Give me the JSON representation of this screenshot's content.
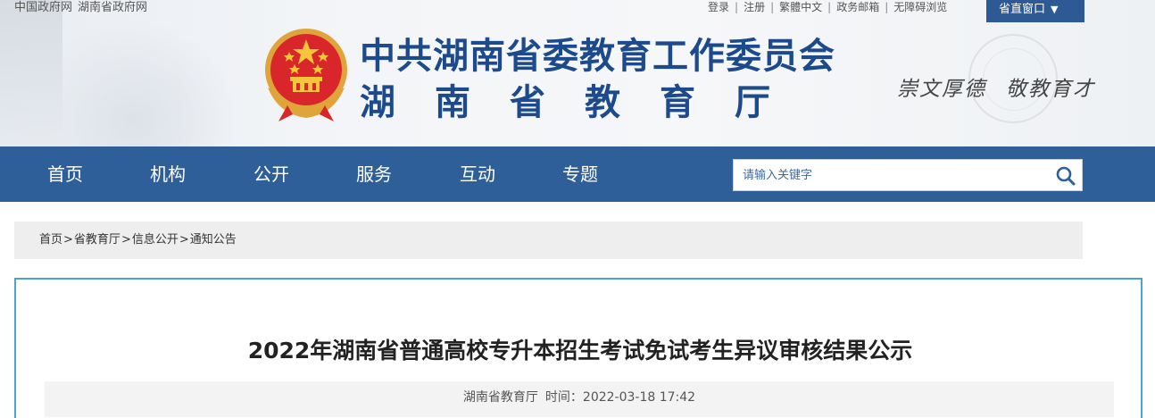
{
  "top_links": {
    "left": [
      "中国政府网",
      "湖南省政府网"
    ],
    "right": [
      "登录",
      "注册",
      "繁體中文",
      "政务邮箱",
      "无障碍浏览"
    ],
    "province_button": "省直窗口",
    "province_arrow": "▼"
  },
  "header": {
    "title_line1": "中共湖南省委教育工作委员会",
    "title_line2": "湖南省教育厅",
    "motto_part1": "崇文厚德",
    "motto_part2": "敬教育才"
  },
  "nav": {
    "items": [
      "首页",
      "机构",
      "公开",
      "服务",
      "互动",
      "专题"
    ]
  },
  "search": {
    "placeholder": "请输入关键字"
  },
  "breadcrumb": {
    "items": [
      "首页",
      "省教育厅",
      "信息公开",
      "通知公告"
    ],
    "separator": ">"
  },
  "article": {
    "title": "2022年湖南省普通高校专升本招生考试免试考生异议审核结果公示",
    "source": "湖南省教育厅",
    "time_label": "时间：",
    "time": "2022-03-18 17:42"
  },
  "colors": {
    "nav_bg": "#2e5f98",
    "title_blue": "#1c4a8c",
    "content_border": "#4aa3d6"
  }
}
